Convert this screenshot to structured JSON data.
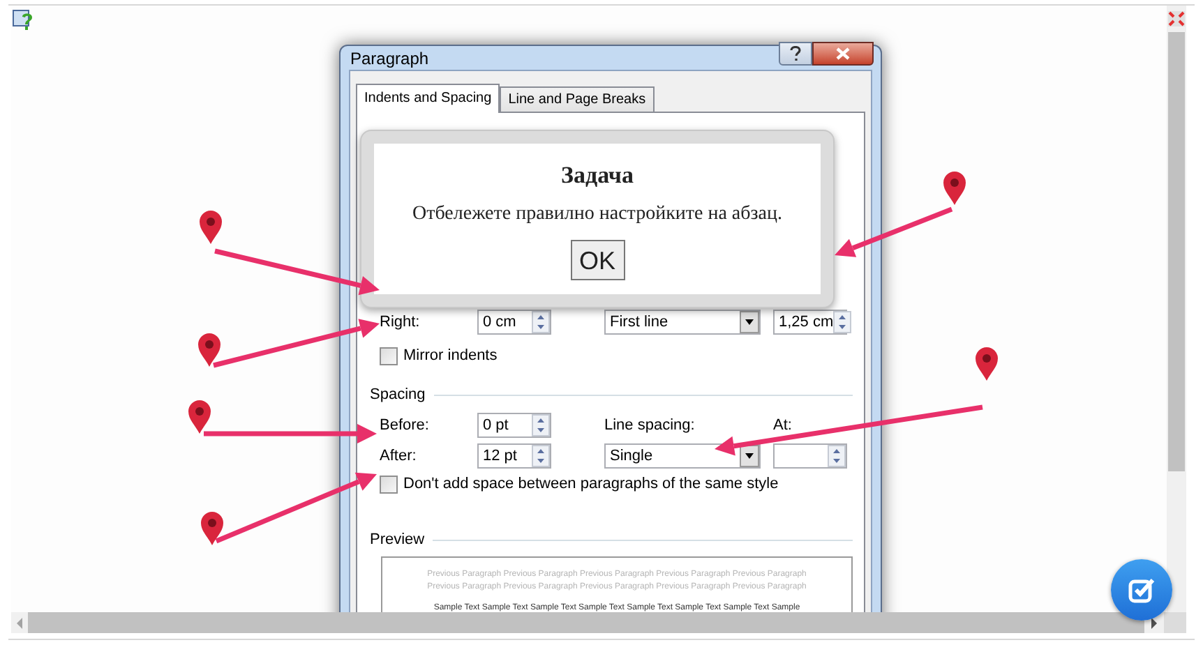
{
  "dialog": {
    "title": "Paragraph",
    "tabs": [
      {
        "label": "Indents and Spacing",
        "selected": true
      },
      {
        "label": "Line and Page Breaks",
        "selected": false
      }
    ],
    "right": {
      "label": "Right:",
      "value": "0 cm"
    },
    "special": {
      "value": "First line"
    },
    "by": {
      "value": "1,25 cm"
    },
    "mirror_indents": {
      "label": "Mirror indents",
      "checked": false
    },
    "spacing": {
      "heading": "Spacing",
      "before": {
        "label": "Before:",
        "value": "0 pt"
      },
      "after": {
        "label": "After:",
        "value": "12 pt"
      },
      "line_spacing": {
        "label": "Line spacing:",
        "value": "Single"
      },
      "at": {
        "label": "At:"
      }
    },
    "dont_add_space": {
      "label": "Don't add space between paragraphs of the same style",
      "checked": false
    },
    "preview": {
      "heading": "Preview",
      "previous_lines": [
        "Previous Paragraph Previous Paragraph Previous Paragraph Previous Paragraph Previous Paragraph",
        "Previous Paragraph Previous Paragraph Previous Paragraph Previous Paragraph Previous Paragraph"
      ],
      "sample_lines": [
        "Sample Text Sample Text Sample Text Sample Text Sample Text Sample Text Sample Text Sample"
      ]
    }
  },
  "task_popup": {
    "title": "Задача",
    "message": "Отбележете правилно настройките на абзац.",
    "button": "OK"
  }
}
